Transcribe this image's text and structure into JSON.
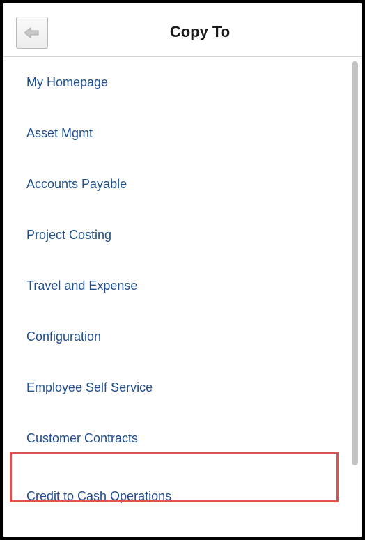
{
  "header": {
    "title": "Copy To",
    "back_icon": "arrow-left-icon"
  },
  "menu": {
    "items": [
      "My Homepage",
      "Asset Mgmt",
      "Accounts Payable",
      "Project Costing",
      "Travel and Expense",
      "Configuration",
      "Employee Self Service",
      "Customer Contracts",
      "Credit to Cash Operations"
    ],
    "highlighted_item": "Credit to Cash Operations"
  },
  "colors": {
    "link": "#1f4e8c",
    "highlight_border": "#e0524c",
    "frame_border": "#000000"
  }
}
